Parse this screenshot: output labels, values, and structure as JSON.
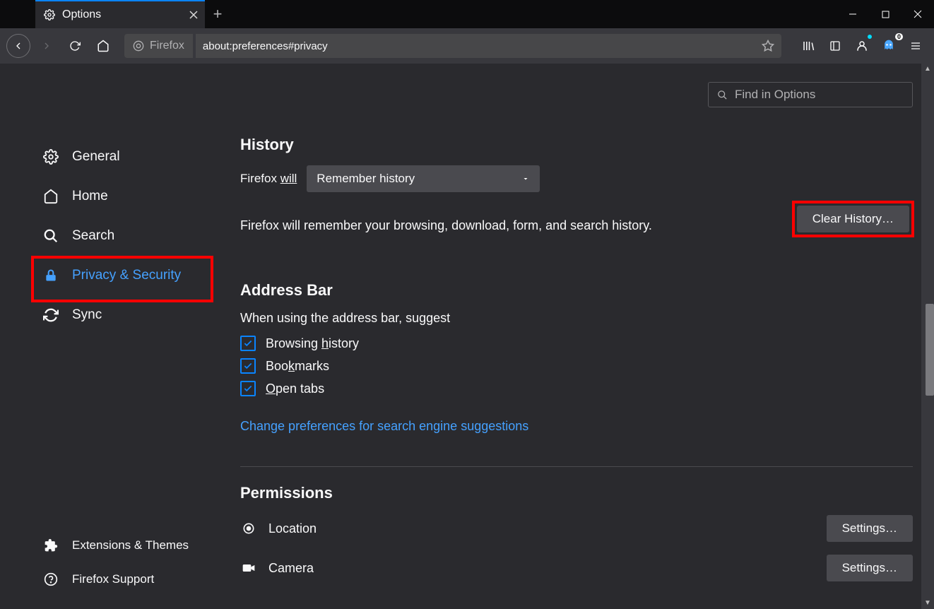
{
  "tab": {
    "title": "Options"
  },
  "urlbar": {
    "identity": "Firefox",
    "url": "about:preferences#privacy"
  },
  "search": {
    "placeholder": "Find in Options"
  },
  "sidebar": {
    "items": [
      {
        "label": "General"
      },
      {
        "label": "Home"
      },
      {
        "label": "Search"
      },
      {
        "label": "Privacy & Security"
      },
      {
        "label": "Sync"
      }
    ],
    "footer": [
      {
        "label": "Extensions & Themes"
      },
      {
        "label": "Firefox Support"
      }
    ]
  },
  "history": {
    "title": "History",
    "label_prefix": "Firefox ",
    "label_will": "will",
    "select_value": "Remember history",
    "desc": "Firefox will remember your browsing, download, form, and search history.",
    "clear_btn": "Clear History…"
  },
  "addressbar": {
    "title": "Address Bar",
    "subtitle": "When using the address bar, suggest",
    "checks": [
      {
        "label_pre": "Browsing ",
        "label_u": "h",
        "label_post": "istory"
      },
      {
        "label_pre": "Boo",
        "label_u": "k",
        "label_post": "marks"
      },
      {
        "label_pre": "",
        "label_u": "O",
        "label_post": "pen tabs"
      }
    ],
    "link": "Change preferences for search engine suggestions"
  },
  "permissions": {
    "title": "Permissions",
    "items": [
      {
        "label": "Location",
        "btn": "Settings…"
      },
      {
        "label": "Camera",
        "btn": "Settings…"
      }
    ]
  },
  "ghostery_badge": "0"
}
